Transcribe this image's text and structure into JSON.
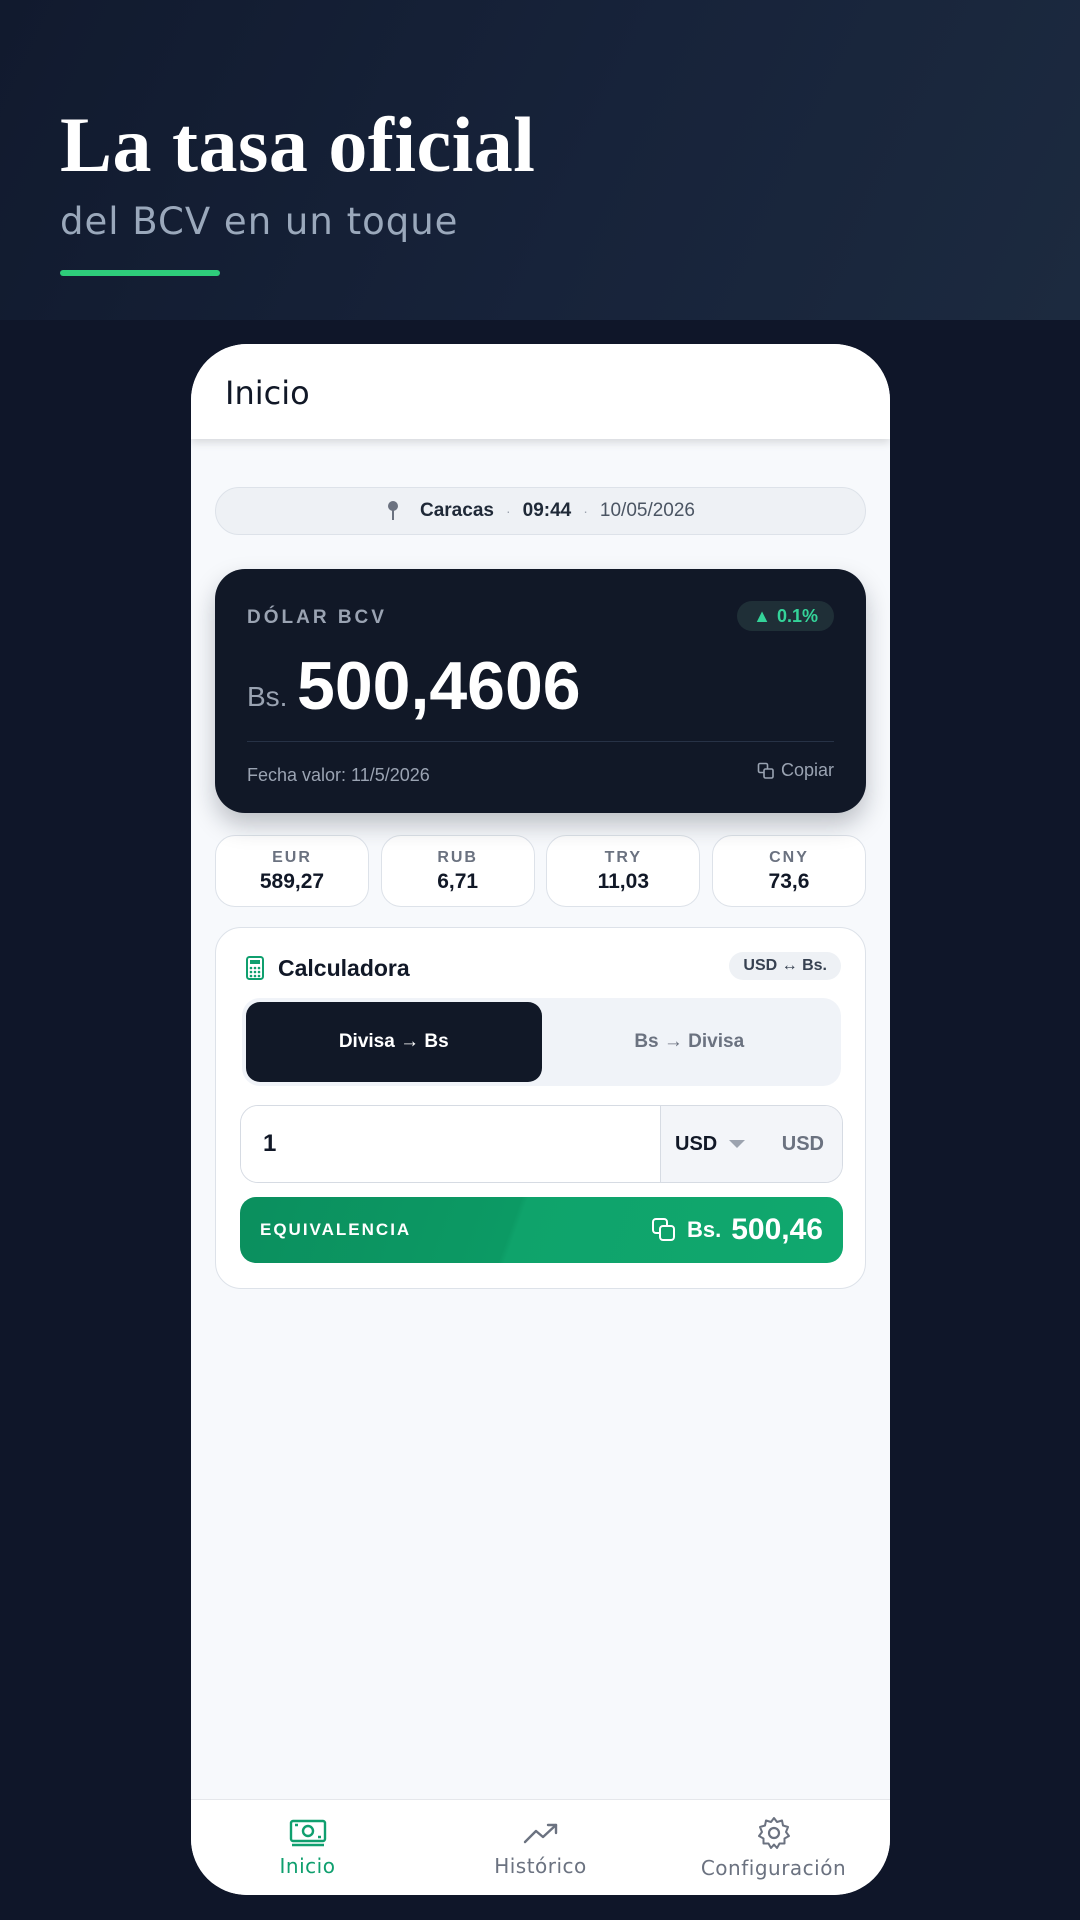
{
  "hero": {
    "title": "La tasa oficial",
    "subtitle": "del BCV en un toque"
  },
  "colors": {
    "background": "#0f1629",
    "accent_green": "#0f9f6e",
    "card_dark": "#111827",
    "badge_green": "#34d399"
  },
  "appbar": {
    "title": "Inicio"
  },
  "location": {
    "icon": "pin-icon",
    "city": "Caracas",
    "separator": "·",
    "time": "09:44",
    "date": "10/05/2026"
  },
  "rate_card": {
    "label": "DÓLAR BCV",
    "change_arrow": "▲",
    "change": "0.1%",
    "currency": "Bs.",
    "value": "500,4606",
    "value_date": "Fecha valor: 11/5/2026",
    "copy_label": "Copiar",
    "copy_icon": "copy-icon"
  },
  "currencies": [
    {
      "code": "EUR",
      "value": "589,27"
    },
    {
      "code": "RUB",
      "value": "6,71"
    },
    {
      "code": "TRY",
      "value": "11,03"
    },
    {
      "code": "CNY",
      "value": "73,6"
    }
  ],
  "calculator": {
    "icon": "calculator-icon",
    "title": "Calculadora",
    "badge": "USD ↔ Bs.",
    "modes": [
      {
        "label": "Divisa → Bs",
        "active": true
      },
      {
        "label": "Bs → Divisa",
        "active": false
      }
    ],
    "amount": "1",
    "selected_currency": "USD",
    "suffix": "USD",
    "result_label": "EQUIVALENCIA",
    "result_currency": "Bs.",
    "result_value": "500,46"
  },
  "nav": [
    {
      "label": "Inicio",
      "icon": "money-icon",
      "active": true
    },
    {
      "label": "Histórico",
      "icon": "trending-up-icon",
      "active": false
    },
    {
      "label": "Configuración",
      "icon": "gear-icon",
      "active": false
    }
  ]
}
